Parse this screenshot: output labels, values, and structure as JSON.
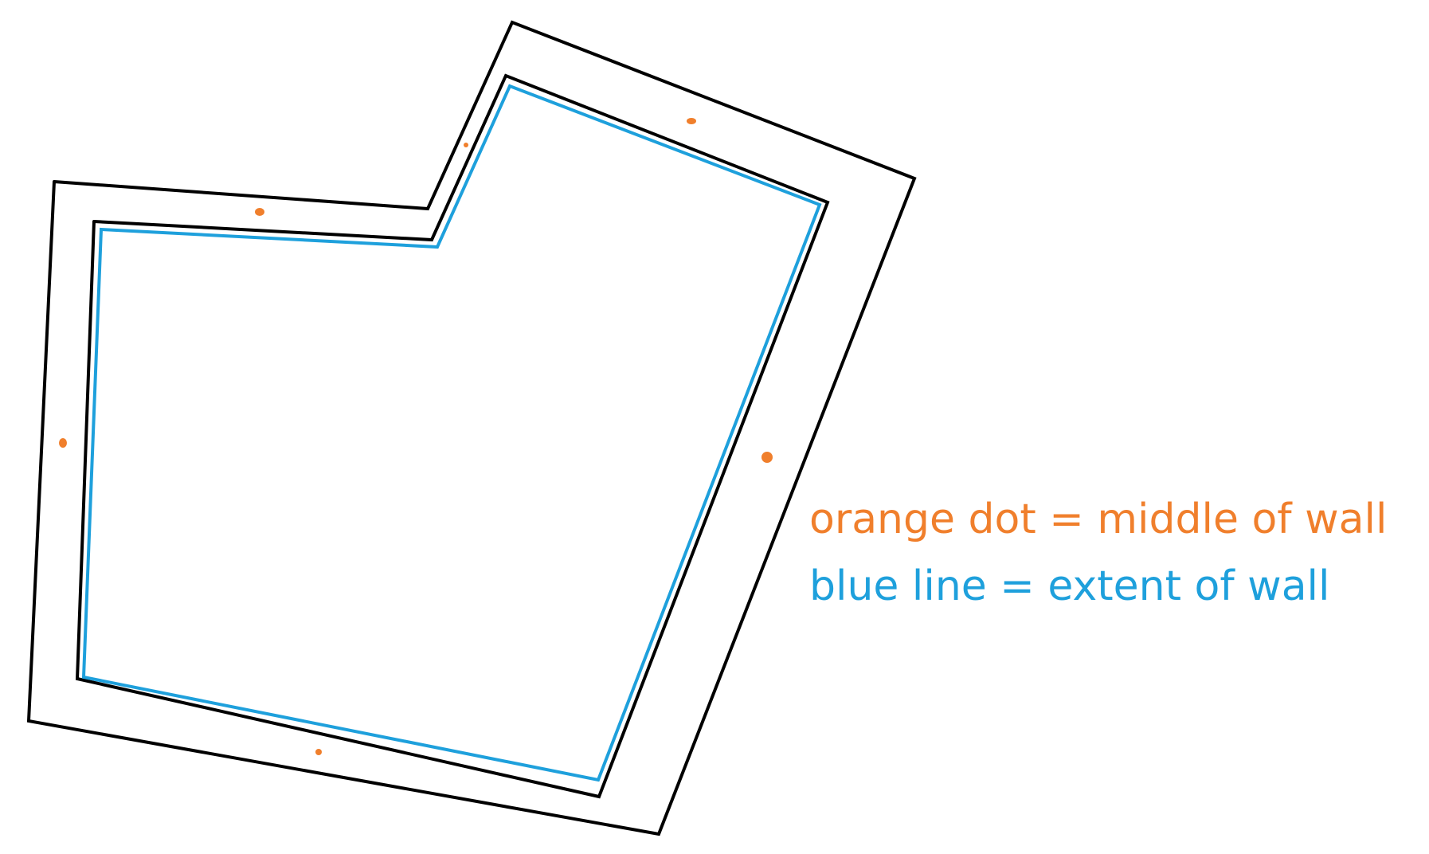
{
  "colors": {
    "wall_outline": "#000000",
    "wall_extent": "#1ea0dc",
    "wall_middle": "#f07f2c",
    "background": "#ffffff"
  },
  "legend": {
    "orange_dot": "orange dot = middle of wall",
    "blue_line": "blue line = extent of wall"
  }
}
